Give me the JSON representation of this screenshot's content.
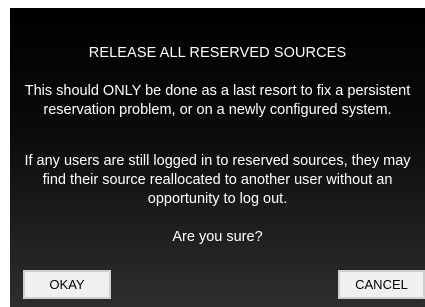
{
  "dialog": {
    "title": "RELEASE ALL RESERVED SOURCES",
    "paragraph1": "This should ONLY be done as a last resort to fix a persistent reservation problem, or on a newly configured system.",
    "paragraph2": "If any users are still logged in to reserved sources, they may find their source reallocated to another user without an opportunity to log out.",
    "question": "Are you sure?",
    "okay_label": "OKAY",
    "cancel_label": "CANCEL"
  }
}
